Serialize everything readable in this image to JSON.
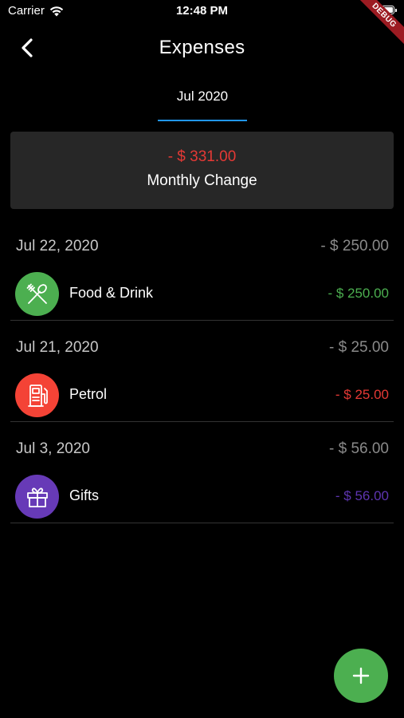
{
  "status_bar": {
    "carrier": "Carrier",
    "time": "12:48 PM",
    "battery_level": 1.0
  },
  "debug_banner": "DEBUG",
  "app_bar": {
    "title": "Expenses"
  },
  "tabs": [
    {
      "label": "Jul 2020",
      "selected": true
    }
  ],
  "summary": {
    "amount": "-  $ 331.00",
    "label": "Monthly Change",
    "amount_color": "#e53935"
  },
  "groups": [
    {
      "date": "Jul 22, 2020",
      "total": "-  $ 250.00",
      "transaction": {
        "name": "Food & Drink",
        "amount": "-  $ 250.00",
        "icon": "fork-spoon-icon",
        "color": "#4caf50"
      }
    },
    {
      "date": "Jul 21, 2020",
      "total": "-  $ 25.00",
      "transaction": {
        "name": "Petrol",
        "amount": "-  $ 25.00",
        "icon": "gas-station-icon",
        "color": "#f44336"
      }
    },
    {
      "date": "Jul 3, 2020",
      "total": "-  $ 56.00",
      "transaction": {
        "name": "Gifts",
        "amount": "-  $ 56.00",
        "icon": "gift-icon",
        "color": "#673ab7"
      }
    }
  ],
  "fab": {
    "icon": "plus-icon",
    "color": "#4caf50"
  },
  "colors": {
    "background": "#000000",
    "card": "#272727",
    "tab_indicator": "#2196f3",
    "food_amount": "#4caf50",
    "petrol_amount": "#e53935",
    "gifts_amount": "#5e35b1"
  }
}
